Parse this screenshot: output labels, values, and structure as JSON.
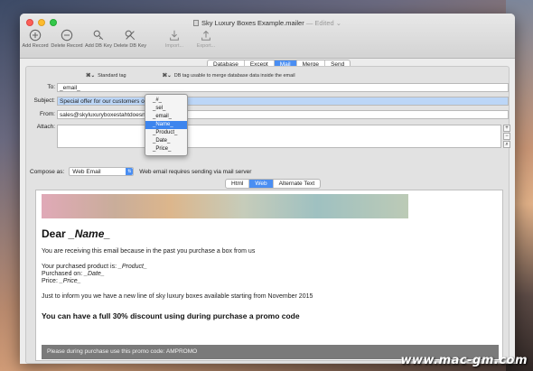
{
  "window": {
    "title": "Sky Luxury Boxes Example.mailer",
    "edited": "— Edited ⌄"
  },
  "toolbar": {
    "add_record": "Add Record",
    "delete_record": "Delete Record",
    "add_db_key": "Add DB Key",
    "delete_db_key": "Delete DB Key",
    "import": "Import...",
    "export": "Export..."
  },
  "top_tabs": [
    "Database",
    "Except",
    "Mail",
    "Merge",
    "Send"
  ],
  "top_tabs_active": "Mail",
  "tags": {
    "standard_key": "⌘⌄",
    "standard_label": "Standard tag",
    "db_key": "⌘⌄",
    "db_label": "DB tag usable to merge database data inside the email"
  },
  "fields": {
    "to_label": "To:",
    "to_value": "_email_",
    "subject_label": "Subject:",
    "subject_value": "Special offer for our customers on",
    "from_label": "From:",
    "from_value": "sales@skyluxuryboxestahtdoesno",
    "attach_label": "Attach:"
  },
  "attach_buttons": [
    "+",
    "−",
    "⌕"
  ],
  "dropdown": {
    "items": [
      "_#_",
      "_sel_",
      "_email_",
      "_Name_",
      "_Product_",
      "_Date_",
      "_Price_"
    ],
    "active": "_Name_"
  },
  "compose": {
    "label": "Compose as:",
    "value": "Web Email",
    "hint": "Web email requires sending via mail server"
  },
  "view_tabs": [
    "Html",
    "Web",
    "Alternate Text"
  ],
  "view_tabs_active": "Web",
  "email": {
    "dear": "Dear",
    "dear_name": "_Name_",
    "line1": "You are receiving this email because in the past you purchase a box from us",
    "product_label": "Your purchased product is:",
    "product_value": "_Product_",
    "date_label": "Purchased on:",
    "date_value": "_Date_",
    "price_label": "Price:",
    "price_value": "_Price_",
    "line2": "Just to inform you we have a new line of sky luxury boxes available starting from November 2015",
    "discount": "You can have a full 30% discount using during purchase a promo code",
    "promo": "Please during purchase use this promo code: AMPROMO"
  },
  "watermark": "www.mac-gm.com"
}
